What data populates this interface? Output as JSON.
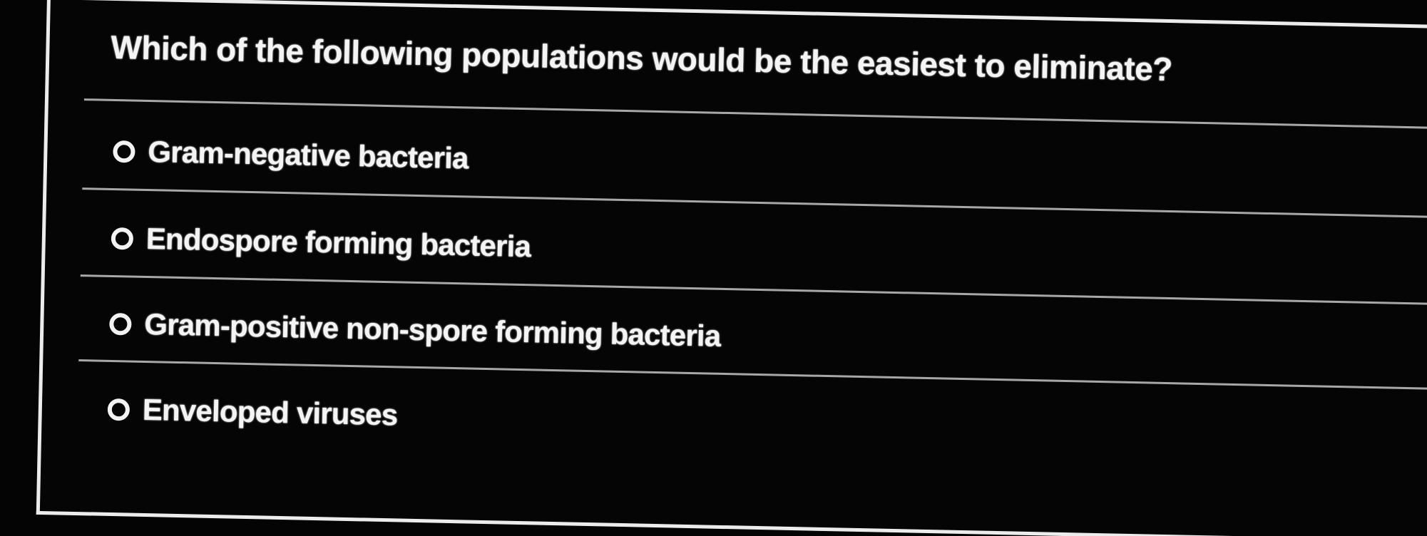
{
  "quiz": {
    "question": "Which of the following populations would be the easiest to eliminate?",
    "options": [
      {
        "label": "Gram-negative bacteria",
        "selected": false
      },
      {
        "label": "Endospore forming bacteria",
        "selected": false
      },
      {
        "label": "Gram-positive non-spore forming bacteria",
        "selected": false
      },
      {
        "label": "Enveloped viruses",
        "selected": false
      }
    ]
  },
  "colors": {
    "background": "#050505",
    "text": "#f4f4f4",
    "panel_border": "#ececec",
    "divider": "#a7a7a7"
  },
  "icons": {
    "radio": "radio-unselected-icon"
  }
}
